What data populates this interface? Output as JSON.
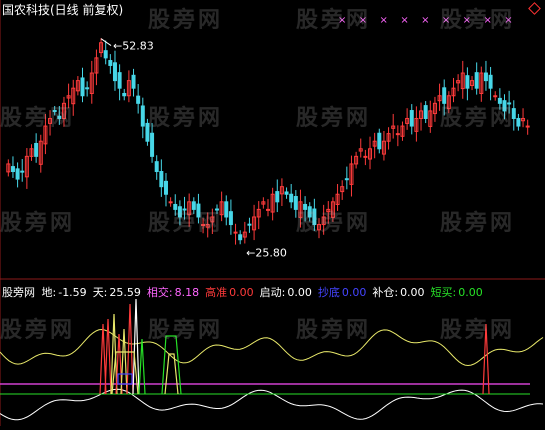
{
  "header": {
    "title": "国农科技(日线 前复权)"
  },
  "watermark": "股旁网",
  "colors": {
    "background": "#000000",
    "up": "#ff3b3b",
    "down": "#47d7e8",
    "marker": "#ff66ff",
    "white": "#ffffff",
    "yellow": "#e8e86a",
    "green": "#27e227",
    "purple": "#d040d0",
    "blue": "#4444ff"
  },
  "price_labels": {
    "high": "52.83",
    "low": "25.80"
  },
  "indicator": {
    "name": "股旁网",
    "items": [
      {
        "label": "地:",
        "value": "-1.59",
        "color": "#ffffff"
      },
      {
        "label": "天:",
        "value": "25.59",
        "color": "#ffffff"
      },
      {
        "label": "相交:",
        "value": "8.18",
        "color": "#ff66ff",
        "value_color": "#ff66ff"
      },
      {
        "label": "高准",
        "value": "0.00",
        "color": "#ff3b3b",
        "value_color": "#ff3b3b"
      },
      {
        "label": "启动:",
        "value": "0.00",
        "color": "#ffffff",
        "value_color": "#ffffff"
      },
      {
        "label": "抄底",
        "value": "0.00",
        "color": "#4444ff",
        "value_color": "#4444ff"
      },
      {
        "label": "补仓:",
        "value": "0.00",
        "color": "#ffffff",
        "value_color": "#ffffff"
      },
      {
        "label": "短买:",
        "value": "0.00",
        "color": "#27e227",
        "value_color": "#27e227"
      }
    ]
  },
  "chart_data": [
    {
      "type": "candlestick",
      "price_range": [
        22,
        55
      ],
      "high_mark": 52.83,
      "low_mark": 25.8,
      "close": [
        36,
        35,
        34,
        35,
        37,
        38,
        37,
        39,
        41,
        42,
        43,
        42,
        44,
        45,
        46,
        47,
        45,
        46,
        48,
        50,
        52,
        50,
        49,
        47,
        46,
        45,
        47,
        46,
        44,
        41,
        39,
        37,
        35,
        33,
        32,
        31,
        30,
        29,
        30,
        31,
        30,
        29,
        28,
        28,
        29,
        30,
        31,
        29,
        28,
        27,
        26,
        27,
        28,
        29,
        30,
        31,
        30,
        32,
        31,
        33,
        32,
        31,
        30,
        31,
        30,
        29,
        28,
        28,
        29,
        30,
        31,
        32,
        33,
        34,
        36,
        37,
        38,
        37,
        38,
        39,
        38,
        39,
        40,
        41,
        40,
        41,
        42,
        41,
        42,
        43,
        42,
        43,
        44,
        45,
        44,
        45,
        46,
        47,
        48,
        46,
        47,
        46,
        48,
        47,
        46,
        45,
        44,
        43,
        44,
        42,
        41,
        42,
        41
      ],
      "markers_count": 9
    },
    {
      "type": "line",
      "series": [
        {
          "name": "天",
          "last": 25.59
        },
        {
          "name": "地",
          "last": -1.59
        }
      ]
    }
  ]
}
